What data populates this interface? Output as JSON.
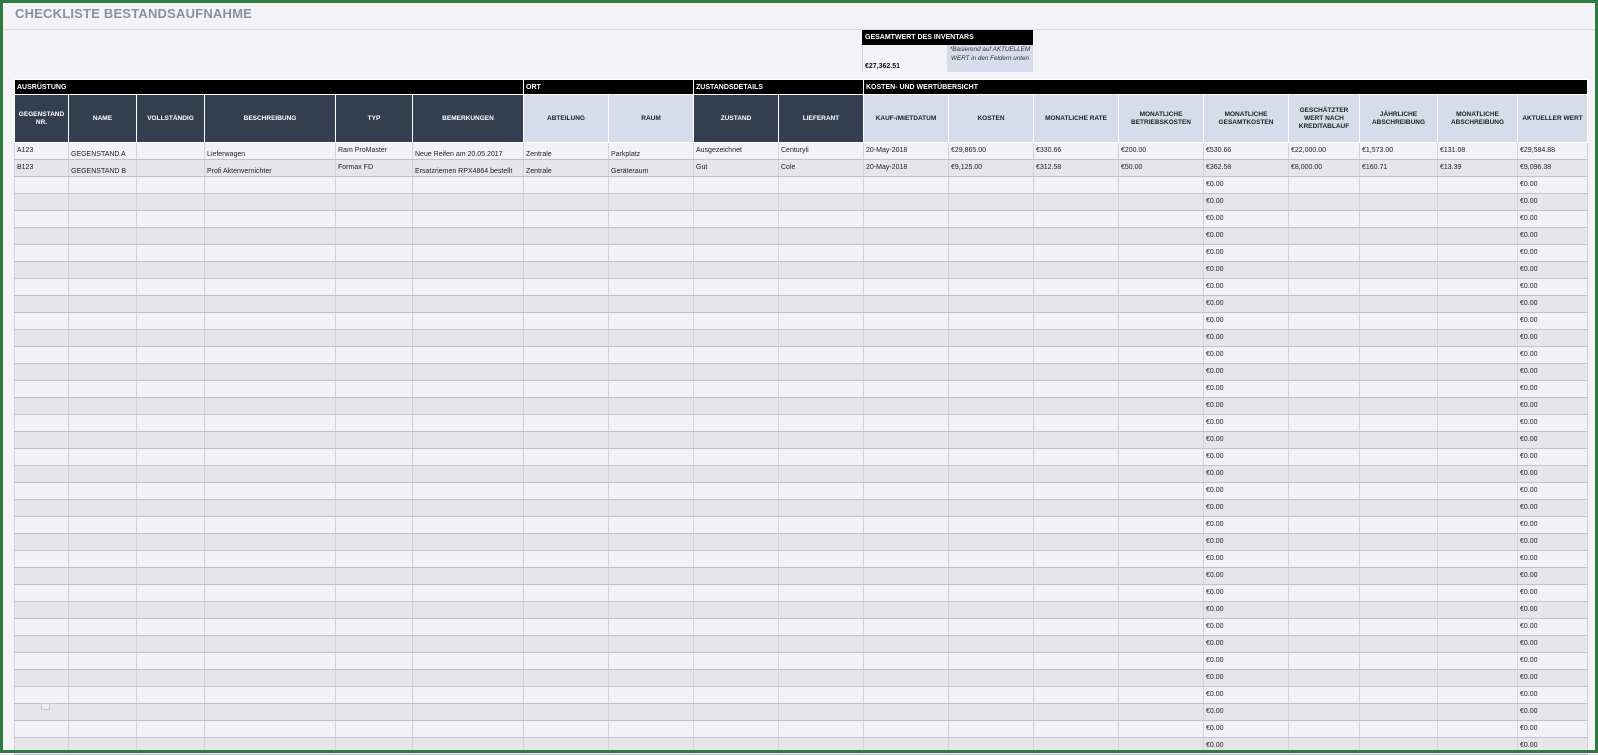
{
  "title": "CHECKLISTE BESTANDSAUFNAHME",
  "summary": {
    "label": "GESAMTWERT DES INVENTARS",
    "value": "€27,362.51",
    "note": "*Basierend auf AKTUELLEM WERT in den Feldern unten"
  },
  "sections": {
    "equipment": "AUSRÜSTUNG",
    "location": "ORT",
    "condition": "ZUSTANDSDETAILS",
    "costs": "KOSTEN- UND WERTÜBERSICHT"
  },
  "columns": [
    "GEGENSTAND NR.",
    "NAME",
    "VOLLSTÄNDIG",
    "BESCHREIBUNG",
    "TYP",
    "BEMERKUNGEN",
    "ABTEILUNG",
    "RAUM",
    "ZUSTAND",
    "LIEFERANT",
    "KAUF-/MIETDATUM",
    "KOSTEN",
    "MONATLICHE RATE",
    "MONATLICHE BETRIEBSKOSTEN",
    "MONATLICHE GESAMTKOSTEN",
    "GESCHÄTZTER WERT NACH KREDITABLAUF",
    "JÄHRLICHE ABSCHREIBUNG",
    "MONATLICHE ABSCHREIBUNG",
    "AKTUELLER WERT"
  ],
  "rows": [
    [
      "A123",
      "GEGENSTAND A",
      "",
      "Lieferwagen",
      "Ram ProMaster",
      "Neue Reifen am 20.05.2017",
      "Zentrale",
      "Parkplatz",
      "Ausgezeichnet",
      "Centuryli",
      "20-May-2018",
      "€29,865.00",
      "€330.66",
      "€200.00",
      "€530.66",
      "€22,000.00",
      "€1,573.00",
      "€131.08",
      "€29,584.88"
    ],
    [
      "B123",
      "GEGENSTAND B",
      "",
      "Profi Aktenvernichter",
      "Formax FD",
      "Ersatzriemen RPX4864 bestellt",
      "Zentrale",
      "Geräteraum",
      "Gut",
      "Cole",
      "20-May-2018",
      "€9,125.00",
      "€312.58",
      "€50.00",
      "€362.58",
      "€8,000.00",
      "€160.71",
      "€13.39",
      "€9,096.38"
    ]
  ],
  "empty_row_total": "€0.00",
  "empty_row_value": "€0.00",
  "empty_row_count": 34
}
